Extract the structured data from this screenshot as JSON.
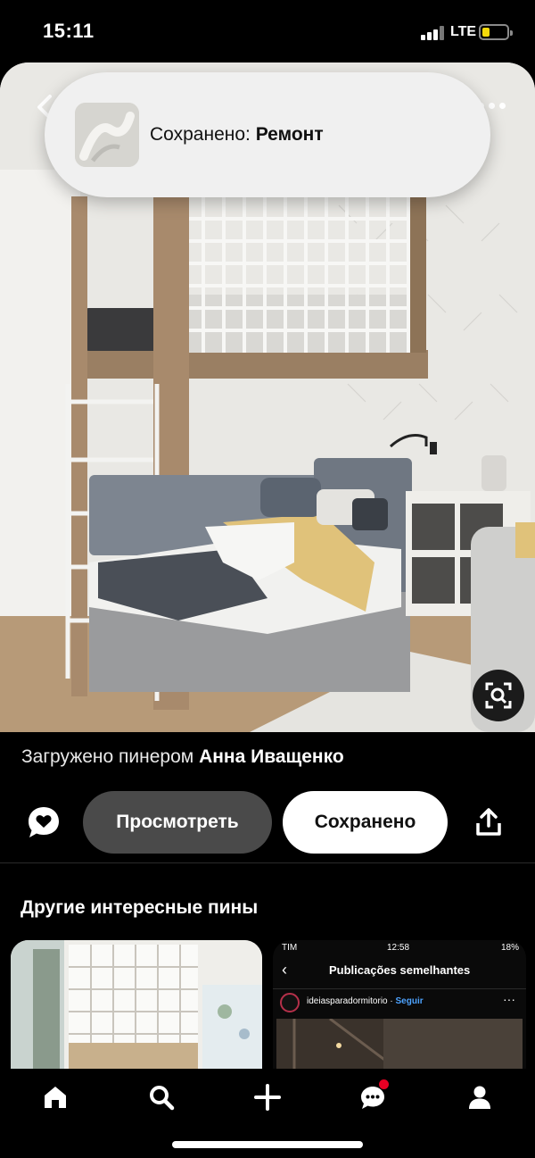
{
  "status_bar": {
    "time": "15:11",
    "network": "LTE"
  },
  "toast": {
    "prefix": "Сохранено: ",
    "board": "Ремонт"
  },
  "pin": {
    "uploaded_prefix": "Загружено пинером ",
    "uploader": "Анна Иващенко"
  },
  "actions": {
    "view_label": "Просмотреть",
    "saved_label": "Сохранено"
  },
  "more_pins": {
    "title": "Другие интересные пины",
    "second_pin": {
      "carrier": "TIM",
      "time": "12:58",
      "battery": "18%",
      "header_title": "Publicações semelhantes",
      "account": "ideiasparadormitorio",
      "separator": " · ",
      "follow": "Seguir"
    }
  },
  "icons": {
    "back": "chevron-left-icon",
    "more": "ellipsis-icon",
    "lens": "visual-search-icon",
    "comment": "comment-heart-icon",
    "share": "share-icon",
    "tabs": [
      "home-icon",
      "search-icon",
      "create-plus-icon",
      "messages-icon",
      "profile-icon"
    ]
  },
  "colors": {
    "accent": "#e60023",
    "follow_blue": "#4da3ff",
    "battery_yellow": "#f5d90a"
  }
}
